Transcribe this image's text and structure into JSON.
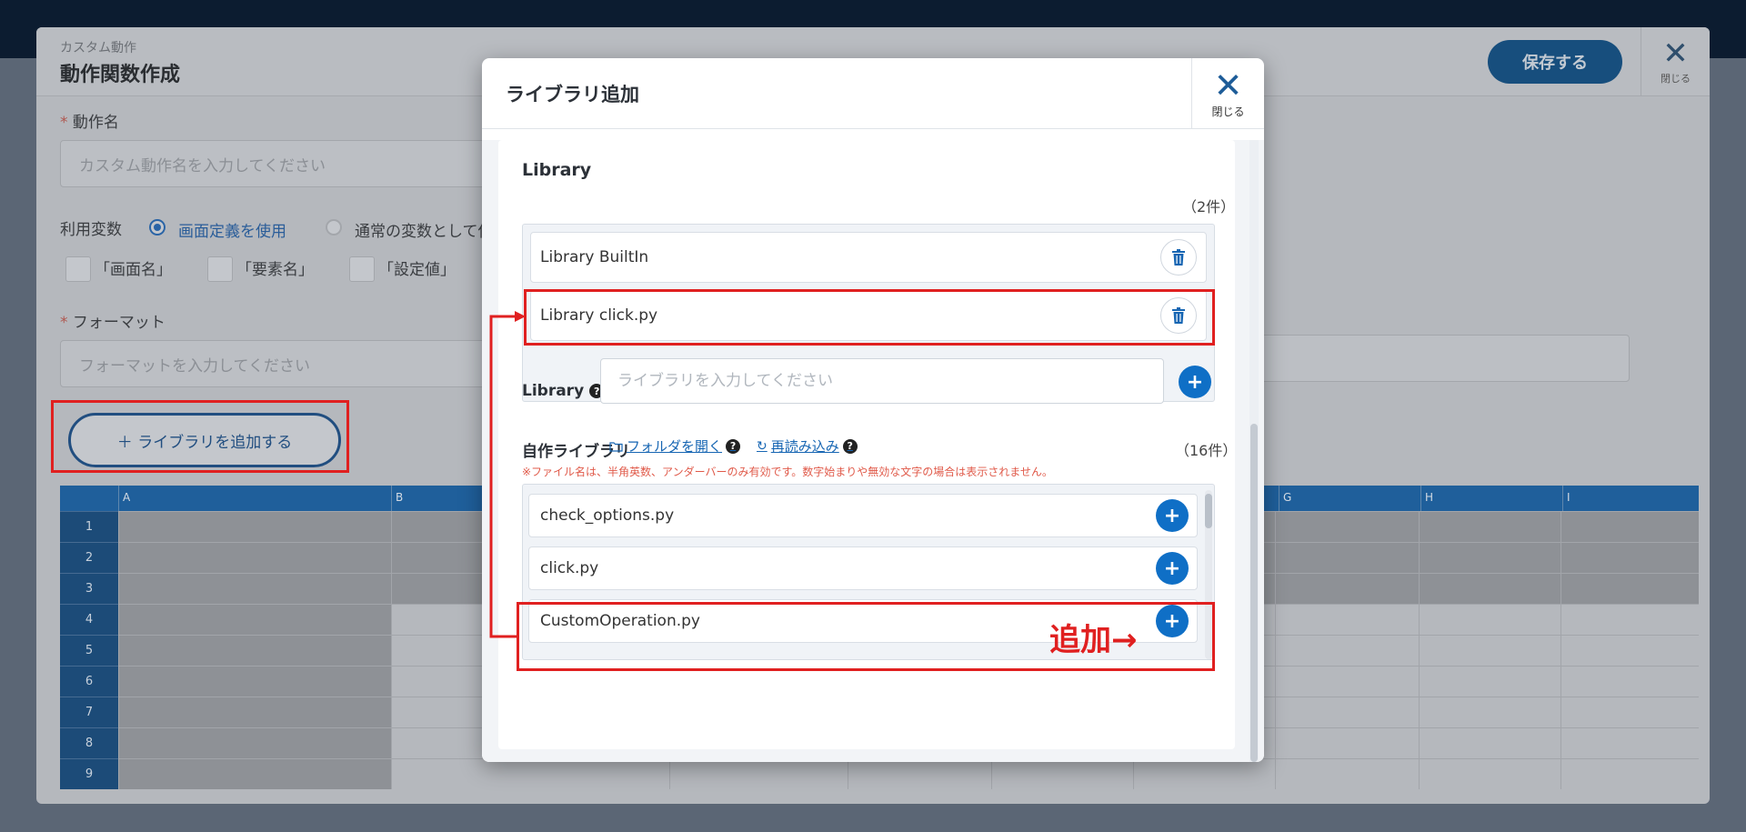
{
  "background_panel": {
    "breadcrumb": "カスタム動作",
    "title": "動作関数作成",
    "save_label": "保存する",
    "close_label": "閉じる",
    "action_name_label": "動作名",
    "action_name_placeholder": "カスタム動作名を入力してください",
    "variables_label": "利用変数",
    "radio_screen_def": "画面定義を使用",
    "radio_normal_var": "通常の変数として使",
    "check_screen_name": "「画面名」",
    "check_element_name": "「要素名」",
    "check_setting_value": "「設定値」",
    "format_label": "フォーマット",
    "format_placeholder": "フォーマットを入力してください",
    "add_library_label": "＋ ライブラリを追加する",
    "grid_columns": [
      "A",
      "B",
      "",
      "",
      "",
      "",
      "",
      "G",
      "H",
      "I"
    ],
    "grid_rows": [
      "1",
      "2",
      "3",
      "4",
      "5",
      "6",
      "7",
      "8",
      "9"
    ]
  },
  "modal": {
    "title": "ライブラリ追加",
    "close_label": "閉じる",
    "library_section_title": "Library",
    "library_count": "（2件）",
    "libraries": [
      {
        "name": "Library BuiltIn"
      },
      {
        "name": "Library click.py"
      }
    ],
    "library_input_label": "Library",
    "library_input_placeholder": "ライブラリを入力してください",
    "own_library_title": "自作ライブラリ",
    "open_folder_label": "フォルダを開く",
    "reload_label": "再読み込み",
    "own_library_count": "（16件）",
    "own_library_warning": "※ファイル名は、半角英数、アンダーバーのみ有効です。数字始まりや無効な文字の場合は表示されません。",
    "own_libraries": [
      {
        "name": "check_options.py"
      },
      {
        "name": "click.py"
      },
      {
        "name": "CustomOperation.py"
      }
    ]
  },
  "annotation": {
    "add_label": "追加→"
  },
  "colors": {
    "accent": "#0f6fc6",
    "highlight": "#e02020",
    "warning": "#e05a4a"
  }
}
